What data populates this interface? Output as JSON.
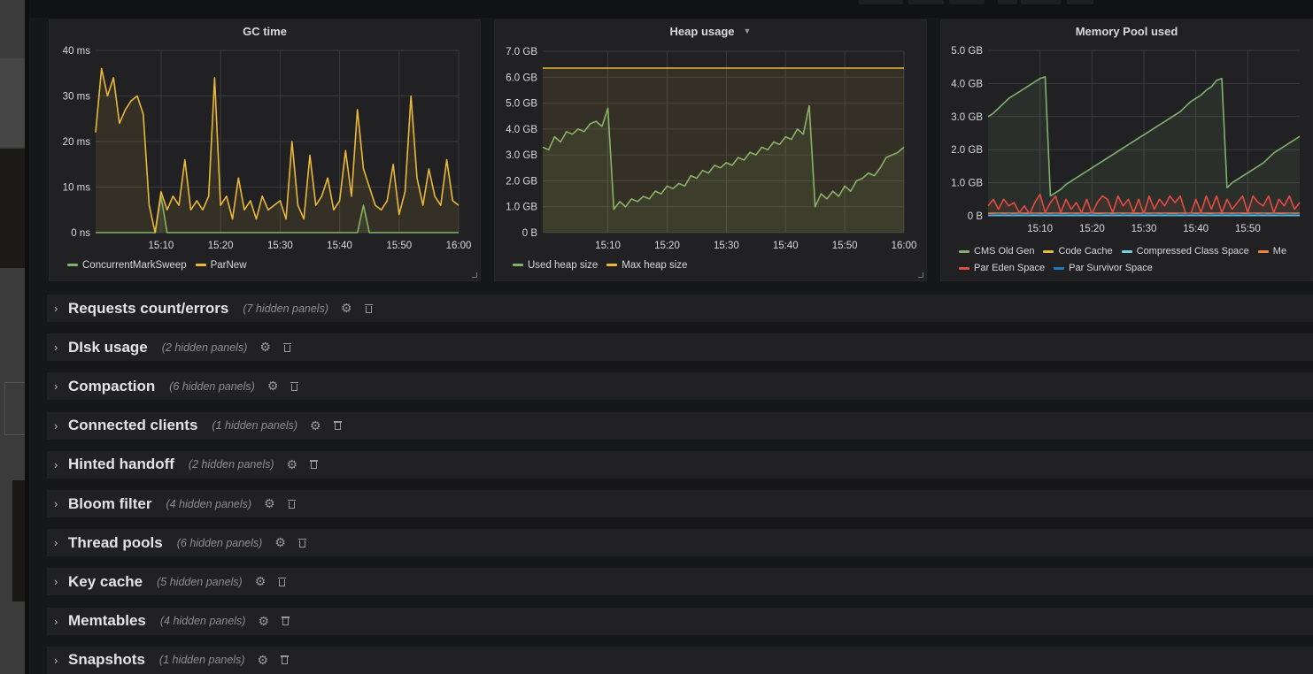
{
  "colors": {
    "green": "#7eb26d",
    "yellow": "#eab839",
    "light_blue": "#6ed0e0",
    "orange": "#ef843c",
    "red": "#e24d42",
    "blue": "#1f78c1"
  },
  "chart_data": [
    {
      "type": "line",
      "title": "GC time",
      "x": [
        "14:59",
        "15:00",
        "15:01",
        "15:02",
        "15:03",
        "15:04",
        "15:05",
        "15:06",
        "15:07",
        "15:08",
        "15:09",
        "15:10",
        "15:11",
        "15:12",
        "15:13",
        "15:14",
        "15:15",
        "15:16",
        "15:17",
        "15:18",
        "15:19",
        "15:20",
        "15:21",
        "15:22",
        "15:23",
        "15:24",
        "15:25",
        "15:26",
        "15:27",
        "15:28",
        "15:29",
        "15:30",
        "15:31",
        "15:32",
        "15:33",
        "15:34",
        "15:35",
        "15:36",
        "15:37",
        "15:38",
        "15:39",
        "15:40",
        "15:41",
        "15:42",
        "15:43",
        "15:44",
        "15:45",
        "15:46",
        "15:47",
        "15:48",
        "15:49",
        "15:50",
        "15:51",
        "15:52",
        "15:53",
        "15:54",
        "15:55",
        "15:56",
        "15:57",
        "15:58",
        "15:59",
        "16:00"
      ],
      "x_ticks": [
        "15:10",
        "15:20",
        "15:30",
        "15:40",
        "15:50",
        "16:00"
      ],
      "y_ticks": [
        "0 ns",
        "10 ms",
        "20 ms",
        "30 ms",
        "40 ms"
      ],
      "ylim": [
        0,
        40
      ],
      "yunit": "ms",
      "grid": true,
      "legend": "bottom",
      "series": [
        {
          "name": "ConcurrentMarkSweep",
          "color": "#7eb26d",
          "values": [
            0,
            0,
            0,
            0,
            0,
            0,
            0,
            0,
            0,
            0,
            0,
            8,
            0,
            0,
            0,
            0,
            0,
            0,
            0,
            0,
            0,
            0,
            0,
            0,
            0,
            0,
            0,
            0,
            0,
            0,
            0,
            0,
            0,
            0,
            0,
            0,
            0,
            0,
            0,
            0,
            0,
            0,
            0,
            0,
            0,
            6,
            0,
            0,
            0,
            0,
            0,
            0,
            0,
            0,
            0,
            0,
            0,
            0,
            0,
            0,
            0,
            0
          ]
        },
        {
          "name": "ParNew",
          "color": "#eab839",
          "values": [
            22,
            36,
            30,
            34,
            24,
            27,
            29,
            30,
            26,
            6,
            0,
            9,
            5,
            8,
            6,
            16,
            5,
            7,
            5,
            8,
            34,
            6,
            8,
            3,
            12,
            5,
            7,
            3,
            8,
            5,
            6,
            7,
            3,
            20,
            6,
            3,
            17,
            6,
            8,
            12,
            5,
            7,
            18,
            8,
            27,
            14,
            10,
            6,
            5,
            7,
            15,
            4,
            9,
            30,
            12,
            6,
            14,
            8,
            6,
            16,
            7,
            6
          ]
        }
      ]
    },
    {
      "type": "line",
      "title": "Heap usage",
      "x": [
        "14:59",
        "15:00",
        "15:01",
        "15:02",
        "15:03",
        "15:04",
        "15:05",
        "15:06",
        "15:07",
        "15:08",
        "15:09",
        "15:10",
        "15:11",
        "15:12",
        "15:13",
        "15:14",
        "15:15",
        "15:16",
        "15:17",
        "15:18",
        "15:19",
        "15:20",
        "15:21",
        "15:22",
        "15:23",
        "15:24",
        "15:25",
        "15:26",
        "15:27",
        "15:28",
        "15:29",
        "15:30",
        "15:31",
        "15:32",
        "15:33",
        "15:34",
        "15:35",
        "15:36",
        "15:37",
        "15:38",
        "15:39",
        "15:40",
        "15:41",
        "15:42",
        "15:43",
        "15:44",
        "15:45",
        "15:46",
        "15:47",
        "15:48",
        "15:49",
        "15:50",
        "15:51",
        "15:52",
        "15:53",
        "15:54",
        "15:55",
        "15:56",
        "15:57",
        "15:58",
        "15:59",
        "16:00"
      ],
      "x_ticks": [
        "15:10",
        "15:20",
        "15:30",
        "15:40",
        "15:50",
        "16:00"
      ],
      "y_ticks": [
        "0 B",
        "1.0 GB",
        "2.0 GB",
        "3.0 GB",
        "4.0 GB",
        "5.0 GB",
        "6.0 GB",
        "7.0 GB"
      ],
      "ylim": [
        0,
        7
      ],
      "yunit": "GB",
      "grid": true,
      "legend": "bottom",
      "series": [
        {
          "name": "Used heap size",
          "color": "#7eb26d",
          "values": [
            3.3,
            3.2,
            3.7,
            3.5,
            3.9,
            3.8,
            4.0,
            3.9,
            4.2,
            4.3,
            4.1,
            4.8,
            0.9,
            1.2,
            1.0,
            1.3,
            1.2,
            1.4,
            1.3,
            1.6,
            1.5,
            1.8,
            1.7,
            1.9,
            1.8,
            2.2,
            2.1,
            2.4,
            2.3,
            2.6,
            2.5,
            2.7,
            2.6,
            2.9,
            2.8,
            3.1,
            3.0,
            3.3,
            3.2,
            3.5,
            3.4,
            3.7,
            3.6,
            4.0,
            3.8,
            4.9,
            1.0,
            1.5,
            1.3,
            1.6,
            1.4,
            1.8,
            1.6,
            2.0,
            2.1,
            2.3,
            2.2,
            2.5,
            2.9,
            3.0,
            3.1,
            3.3
          ]
        },
        {
          "name": "Max heap size",
          "color": "#eab839",
          "values": [
            6.35,
            6.35,
            6.35,
            6.35,
            6.35,
            6.35,
            6.35,
            6.35,
            6.35,
            6.35,
            6.35,
            6.35,
            6.35,
            6.35,
            6.35,
            6.35,
            6.35,
            6.35,
            6.35,
            6.35,
            6.35,
            6.35,
            6.35,
            6.35,
            6.35,
            6.35,
            6.35,
            6.35,
            6.35,
            6.35,
            6.35,
            6.35,
            6.35,
            6.35,
            6.35,
            6.35,
            6.35,
            6.35,
            6.35,
            6.35,
            6.35,
            6.35,
            6.35,
            6.35,
            6.35,
            6.35,
            6.35,
            6.35,
            6.35,
            6.35,
            6.35,
            6.35,
            6.35,
            6.35,
            6.35,
            6.35,
            6.35,
            6.35,
            6.35,
            6.35,
            6.35,
            6.35
          ]
        }
      ]
    },
    {
      "type": "line",
      "title": "Memory Pool used",
      "x": [
        "15:00",
        "15:01",
        "15:02",
        "15:03",
        "15:04",
        "15:05",
        "15:06",
        "15:07",
        "15:08",
        "15:09",
        "15:10",
        "15:11",
        "15:12",
        "15:13",
        "15:14",
        "15:15",
        "15:16",
        "15:17",
        "15:18",
        "15:19",
        "15:20",
        "15:21",
        "15:22",
        "15:23",
        "15:24",
        "15:25",
        "15:26",
        "15:27",
        "15:28",
        "15:29",
        "15:30",
        "15:31",
        "15:32",
        "15:33",
        "15:34",
        "15:35",
        "15:36",
        "15:37",
        "15:38",
        "15:39",
        "15:40",
        "15:41",
        "15:42",
        "15:43",
        "15:44",
        "15:45",
        "15:46",
        "15:47",
        "15:48",
        "15:49",
        "15:50",
        "15:51",
        "15:52",
        "15:53",
        "15:54",
        "15:55",
        "15:56",
        "15:57",
        "15:58",
        "15:59",
        "16:00"
      ],
      "x_ticks": [
        "15:10",
        "15:20",
        "15:30",
        "15:40",
        "15:50"
      ],
      "y_ticks": [
        "0 B",
        "1.0 GB",
        "2.0 GB",
        "3.0 GB",
        "4.0 GB",
        "5.0 GB"
      ],
      "ylim": [
        0,
        5
      ],
      "yunit": "GB",
      "grid": true,
      "legend": "bottom",
      "series": [
        {
          "name": "CMS Old Gen",
          "color": "#7eb26d",
          "values": [
            3.0,
            3.1,
            3.25,
            3.4,
            3.55,
            3.65,
            3.75,
            3.85,
            3.95,
            4.05,
            4.15,
            4.2,
            0.6,
            0.7,
            0.8,
            0.95,
            1.05,
            1.15,
            1.25,
            1.35,
            1.45,
            1.55,
            1.65,
            1.75,
            1.85,
            1.95,
            2.05,
            2.15,
            2.25,
            2.35,
            2.45,
            2.55,
            2.65,
            2.75,
            2.85,
            2.95,
            3.05,
            3.15,
            3.3,
            3.45,
            3.55,
            3.65,
            3.8,
            3.9,
            4.1,
            4.15,
            0.85,
            1.0,
            1.1,
            1.2,
            1.3,
            1.4,
            1.5,
            1.6,
            1.75,
            1.9,
            2.0,
            2.1,
            2.2,
            2.3,
            2.4
          ]
        },
        {
          "name": "Code Cache",
          "color": "#eab839",
          "values": [
            0.06,
            0.06,
            0.06,
            0.06,
            0.06,
            0.06,
            0.06,
            0.06,
            0.06,
            0.06,
            0.06,
            0.06,
            0.06,
            0.06,
            0.06,
            0.06,
            0.06,
            0.06,
            0.06,
            0.06,
            0.06,
            0.06,
            0.06,
            0.06,
            0.06,
            0.06,
            0.06,
            0.06,
            0.06,
            0.06,
            0.06,
            0.06,
            0.06,
            0.06,
            0.06,
            0.06,
            0.06,
            0.06,
            0.06,
            0.06,
            0.06,
            0.06,
            0.06,
            0.06,
            0.06,
            0.06,
            0.06,
            0.06,
            0.06,
            0.06,
            0.06,
            0.06,
            0.06,
            0.06,
            0.06,
            0.06,
            0.06,
            0.06,
            0.06,
            0.06,
            0.06
          ]
        },
        {
          "name": "Compressed Class Space",
          "color": "#6ed0e0",
          "values": [
            0.01,
            0.01,
            0.01,
            0.01,
            0.01,
            0.01,
            0.01,
            0.01,
            0.01,
            0.01,
            0.01,
            0.01,
            0.01,
            0.01,
            0.01,
            0.01,
            0.01,
            0.01,
            0.01,
            0.01,
            0.01,
            0.01,
            0.01,
            0.01,
            0.01,
            0.01,
            0.01,
            0.01,
            0.01,
            0.01,
            0.01,
            0.01,
            0.01,
            0.01,
            0.01,
            0.01,
            0.01,
            0.01,
            0.01,
            0.01,
            0.01,
            0.01,
            0.01,
            0.01,
            0.01,
            0.01,
            0.01,
            0.01,
            0.01,
            0.01,
            0.01,
            0.01,
            0.01,
            0.01,
            0.01,
            0.01,
            0.01,
            0.01,
            0.01,
            0.01,
            0.01
          ]
        },
        {
          "name": "Me",
          "color": "#ef843c",
          "values": [
            0.08,
            0.08,
            0.08,
            0.08,
            0.08,
            0.08,
            0.08,
            0.08,
            0.08,
            0.08,
            0.08,
            0.08,
            0.08,
            0.08,
            0.08,
            0.08,
            0.08,
            0.08,
            0.08,
            0.08,
            0.08,
            0.08,
            0.08,
            0.08,
            0.08,
            0.08,
            0.08,
            0.08,
            0.08,
            0.08,
            0.08,
            0.08,
            0.08,
            0.08,
            0.08,
            0.08,
            0.08,
            0.08,
            0.08,
            0.08,
            0.08,
            0.08,
            0.08,
            0.08,
            0.08,
            0.08,
            0.08,
            0.08,
            0.08,
            0.08,
            0.08,
            0.08,
            0.08,
            0.08,
            0.08,
            0.08,
            0.08,
            0.08,
            0.08,
            0.08,
            0.08
          ]
        },
        {
          "name": "Par Eden Space",
          "color": "#e24d42",
          "values": [
            0.3,
            0.5,
            0.2,
            0.5,
            0.3,
            0.4,
            0.1,
            0.3,
            0.05,
            0.4,
            0.65,
            0.1,
            0.4,
            0.6,
            0.1,
            0.5,
            0.2,
            0.4,
            0.1,
            0.5,
            0.05,
            0.4,
            0.6,
            0.5,
            0.1,
            0.6,
            0.3,
            0.5,
            0.1,
            0.5,
            0.05,
            0.6,
            0.2,
            0.5,
            0.3,
            0.6,
            0.4,
            0.6,
            0.1,
            0.05,
            0.5,
            0.1,
            0.6,
            0.2,
            0.6,
            0.1,
            0.5,
            0.2,
            0.4,
            0.6,
            0.1,
            0.6,
            0.4,
            0.3,
            0.6,
            0.1,
            0.5,
            0.3,
            0.6,
            0.2,
            0.4
          ]
        },
        {
          "name": "Par Survivor Space",
          "color": "#1f78c1",
          "values": [
            0.04,
            0.04,
            0.05,
            0.04,
            0.05,
            0.04,
            0.05,
            0.04,
            0.04,
            0.05,
            0.04,
            0.05,
            0.04,
            0.05,
            0.04,
            0.04,
            0.05,
            0.04,
            0.05,
            0.04,
            0.05,
            0.04,
            0.04,
            0.05,
            0.04,
            0.05,
            0.04,
            0.05,
            0.04,
            0.04,
            0.05,
            0.04,
            0.05,
            0.04,
            0.05,
            0.04,
            0.04,
            0.05,
            0.04,
            0.05,
            0.04,
            0.05,
            0.04,
            0.04,
            0.05,
            0.04,
            0.05,
            0.04,
            0.05,
            0.04,
            0.04,
            0.05,
            0.04,
            0.05,
            0.04,
            0.05,
            0.04,
            0.04,
            0.05,
            0.04,
            0.05
          ]
        }
      ]
    }
  ],
  "rows": [
    {
      "title": "Requests count/errors",
      "hidden": "(7 hidden panels)"
    },
    {
      "title": "DIsk usage",
      "hidden": "(2 hidden panels)"
    },
    {
      "title": "Compaction",
      "hidden": "(6 hidden panels)"
    },
    {
      "title": "Connected clients",
      "hidden": "(1 hidden panels)"
    },
    {
      "title": "Hinted handoff",
      "hidden": "(2 hidden panels)"
    },
    {
      "title": "Bloom filter",
      "hidden": "(4 hidden panels)"
    },
    {
      "title": "Thread pools",
      "hidden": "(6 hidden panels)"
    },
    {
      "title": "Key cache",
      "hidden": "(5 hidden panels)"
    },
    {
      "title": "Memtables",
      "hidden": "(4 hidden panels)"
    },
    {
      "title": "Snapshots",
      "hidden": "(1 hidden panels)"
    }
  ],
  "icons": {
    "row_expand": "chevron-right-icon",
    "row_settings": "gear-icon",
    "row_delete": "trash-icon",
    "panel_menu": "caret-down-icon"
  }
}
